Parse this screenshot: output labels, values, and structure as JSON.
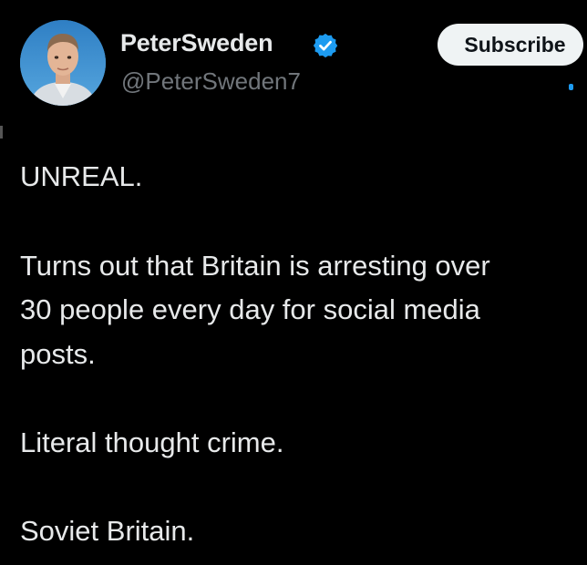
{
  "author": {
    "display_name": "PeterSweden",
    "handle": "@PeterSweden7",
    "avatar_icon": "profile-photo",
    "verified_icon": "verified-badge-icon",
    "verified_color": "#1d9bf0"
  },
  "header": {
    "subscribe_label": "Subscribe"
  },
  "tweet": {
    "lines": [
      "UNREAL.",
      "Turns out that Britain is arresting over",
      "30 people every day for social media",
      "posts.",
      "Literal thought crime.",
      "Soviet Britain."
    ]
  },
  "colors": {
    "background": "#000000",
    "primary_text": "#e7e9ea",
    "secondary_text": "#71767b",
    "button_bg": "#eff3f4",
    "accent": "#1d9bf0"
  }
}
